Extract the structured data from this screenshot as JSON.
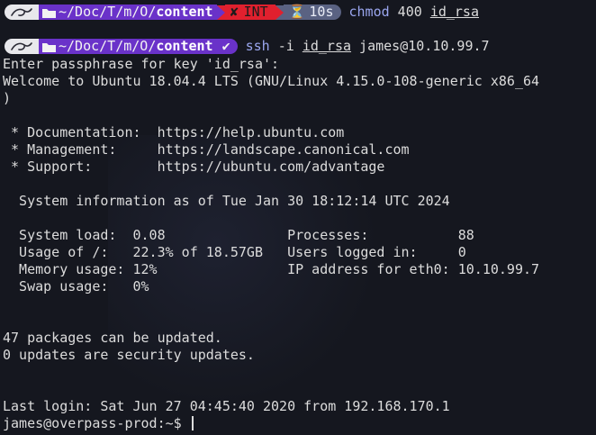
{
  "prompt1": {
    "path_prefix": "~/Doc/T/m/O/",
    "path_current": "content",
    "error_icon": "✘",
    "error_label": "INT",
    "timer_icon": "⏳",
    "timer_label": "10s",
    "command_name": "chmod",
    "command_args_plain": " 400 ",
    "command_arg_underlined": "id_rsa"
  },
  "prompt2": {
    "path_prefix": "~/Doc/T/m/O/",
    "path_current": "content",
    "ok_icon": "✔",
    "command_name": "ssh",
    "command_flag": " -i ",
    "command_arg_underlined": "id_rsa",
    "command_target": " james@10.10.99.7"
  },
  "output": {
    "l1": "Enter passphrase for key 'id_rsa':",
    "l2": "Welcome to Ubuntu 18.04.4 LTS (GNU/Linux 4.15.0-108-generic x86_64",
    "l3": ")",
    "l4": " * Documentation:  https://help.ubuntu.com",
    "l5": " * Management:     https://landscape.canonical.com",
    "l6": " * Support:        https://ubuntu.com/advantage",
    "l7": "  System information as of Tue Jan 30 18:12:14 UTC 2024",
    "l8": "  System load:  0.08               Processes:           88",
    "l9": "  Usage of /:   22.3% of 18.57GB   Users logged in:     0",
    "l10": "  Memory usage: 12%                IP address for eth0: 10.10.99.7",
    "l11": "  Swap usage:   0%",
    "l12": "47 packages can be updated.",
    "l13": "0 updates are security updates.",
    "l14": "Last login: Sat Jun 27 04:45:40 2020 from 192.168.170.1",
    "shell_prompt": "james@overpass-prod:~$ "
  },
  "icons": {
    "logo": "kali-dragon-icon",
    "folder": "folder-icon"
  },
  "colors": {
    "background": "#15171f",
    "path_segment": "#6a32c9",
    "error_segment": "#e0202e",
    "timer_segment": "#5a6282",
    "command": "#9aa6ee",
    "text": "#dcdcdc"
  }
}
